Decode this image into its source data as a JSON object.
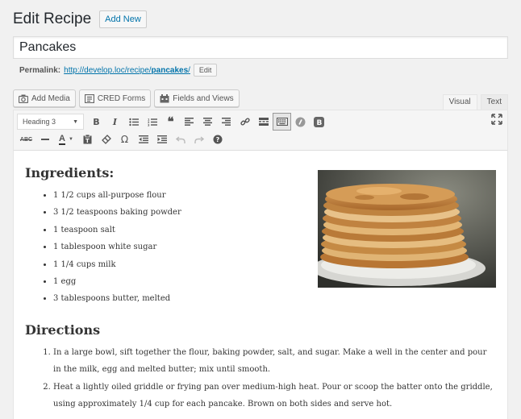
{
  "header": {
    "title": "Edit Recipe",
    "add_new_label": "Add New"
  },
  "post": {
    "title": "Pancakes",
    "permalink_label": "Permalink:",
    "permalink_base": "http://develop.loc/recipe/",
    "permalink_slug": "pancakes",
    "permalink_trail": "/",
    "edit_slug_label": "Edit"
  },
  "media_buttons": [
    {
      "label": "Add Media",
      "icon": "camera-icon"
    },
    {
      "label": "CRED Forms",
      "icon": "form-icon"
    },
    {
      "label": "Fields and Views",
      "icon": "fields-icon"
    }
  ],
  "editor_tabs": {
    "visual": "Visual",
    "text": "Text"
  },
  "toolbar": {
    "format_value": "Heading 3"
  },
  "content": {
    "ingredients_heading": "Ingredients:",
    "ingredients": [
      "1 1/2 cups all-purpose flour",
      "3 1/2 teaspoons baking powder",
      "1 teaspoon salt",
      "1 tablespoon white sugar",
      "1 1/4 cups milk",
      "1 egg",
      "3 tablespoons butter, melted"
    ],
    "directions_heading": "Directions",
    "directions": [
      "In a large bowl, sift together the flour, baking powder, salt, and sugar. Make a well in the center and pour in the milk, egg and melted butter; mix until smooth.",
      "Heat a lightly oiled griddle or frying pan over medium-high heat. Pour or scoop the batter onto the griddle, using approximately 1/4 cup for each pancake. Brown on both sides and serve hot."
    ]
  },
  "colors": {
    "link": "#0073aa",
    "background": "#f1f1f1",
    "text": "#23282d"
  }
}
